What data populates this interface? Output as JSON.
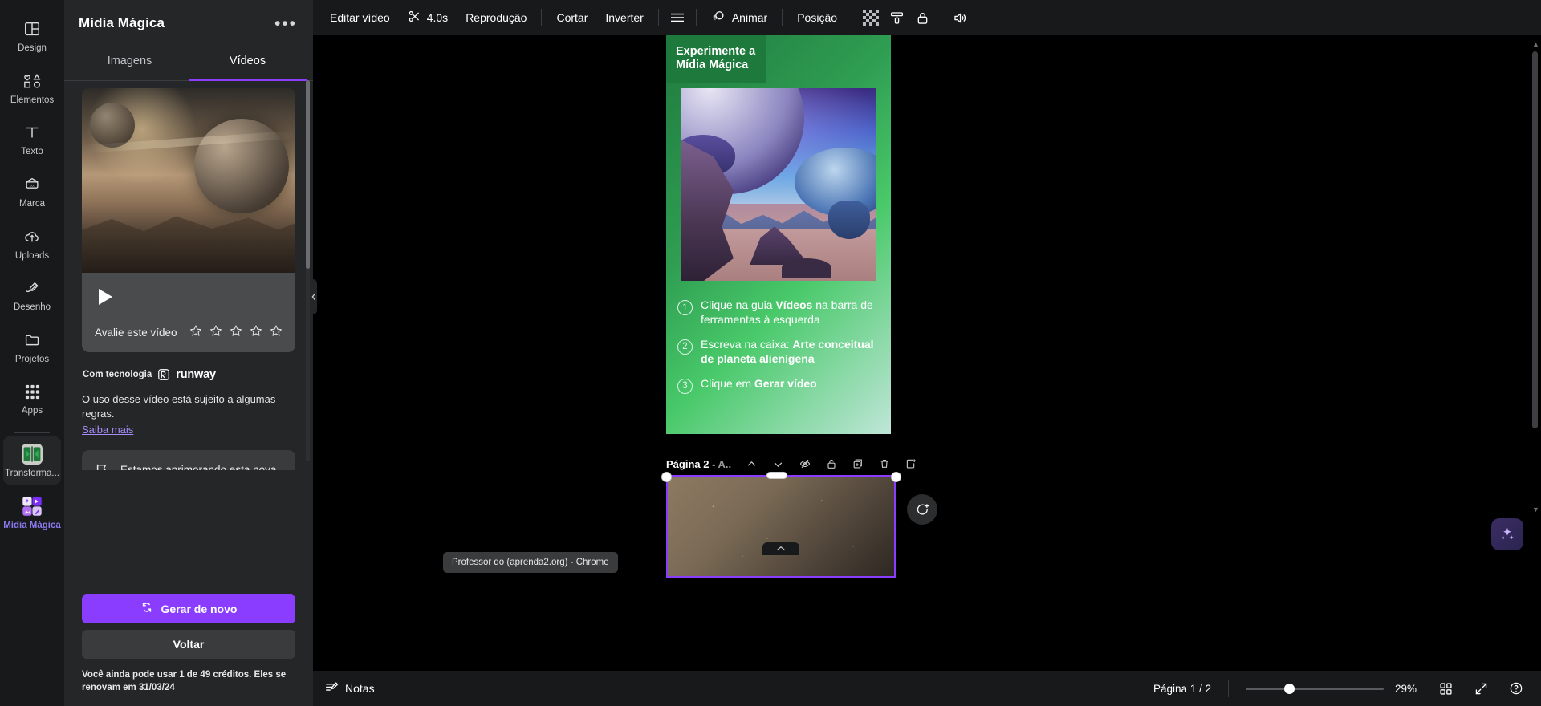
{
  "rail": {
    "items": [
      {
        "label": "Design",
        "icon": "design-icon"
      },
      {
        "label": "Elementos",
        "icon": "elements-icon"
      },
      {
        "label": "Texto",
        "icon": "text-icon"
      },
      {
        "label": "Marca",
        "icon": "brand-icon"
      },
      {
        "label": "Uploads",
        "icon": "uploads-icon"
      },
      {
        "label": "Desenho",
        "icon": "draw-icon"
      },
      {
        "label": "Projetos",
        "icon": "projects-icon"
      },
      {
        "label": "Apps",
        "icon": "apps-grid-icon"
      }
    ],
    "apps": [
      {
        "label": "Transforma...",
        "icon": "transformar-app-icon"
      },
      {
        "label": "Mídia Mágica",
        "icon": "magic-media-app-icon"
      }
    ]
  },
  "panel": {
    "title": "Mídia Mágica",
    "more_label": "•••",
    "tabs": [
      {
        "label": "Imagens",
        "active": false
      },
      {
        "label": "Vídeos",
        "active": true
      }
    ],
    "video_card": {
      "play_label": "play-icon",
      "rate_label": "Avalie este vídeo",
      "stars": 5
    },
    "powered_prefix": "Com tecnologia",
    "powered_brand": "runway",
    "rules_text": "O uso desse vídeo está sujeito a algumas regras.",
    "rules_link": "Saiba mais",
    "feedback_text": "Estamos aprimorando esta nova tecnologia junto com você.",
    "primary_button": "Gerar de novo",
    "secondary_button": "Voltar",
    "credits_text": "Você ainda pode usar 1 de 49 créditos. Eles se renovam em 31/03/24"
  },
  "toolbar": {
    "edit_video": "Editar vídeo",
    "duration": "4.0s",
    "playback": "Reprodução",
    "crop": "Cortar",
    "flip": "Inverter",
    "lines_icon": "align-lines-icon",
    "animate": "Animar",
    "position": "Posição",
    "transparency_icon": "transparency-icon",
    "paint_icon": "paint-roller-icon",
    "lock_icon": "lock-icon",
    "volume_icon": "volume-icon"
  },
  "design": {
    "badge": "Experimente a Mídia Mágica",
    "steps": [
      {
        "num": "1",
        "html": "Clique na guia <b>Vídeos</b> na barra de ferramentas à esquerda"
      },
      {
        "num": "2",
        "html": "Escreva na caixa: <b>Arte conceitual de planeta alienígena</b>"
      },
      {
        "num": "3",
        "html": "Clique em <b>Gerar vídeo</b>"
      }
    ]
  },
  "page_toolbar": {
    "page_name_strong": "Página 2 - ",
    "page_name_dim": "A..",
    "buttons": [
      "move-up-icon",
      "move-down-icon",
      "hide-page-icon",
      "lock-page-icon",
      "duplicate-page-icon",
      "delete-page-icon",
      "add-page-icon"
    ]
  },
  "bottom": {
    "notes": "Notas",
    "tooltip": "Professor do (aprenda2.org) - Chrome",
    "pages": "Página 1 / 2",
    "zoom": "29%",
    "grid_icon": "grid-view-icon",
    "fullscreen_icon": "fullscreen-icon",
    "help_icon": "help-icon"
  },
  "colors": {
    "accent_purple": "#8b3dff",
    "panel_bg": "#252628",
    "rail_bg": "#18191b",
    "canvas_bg": "#000000",
    "card_green": "#2f9e52",
    "link_purple": "#a78bfa"
  }
}
